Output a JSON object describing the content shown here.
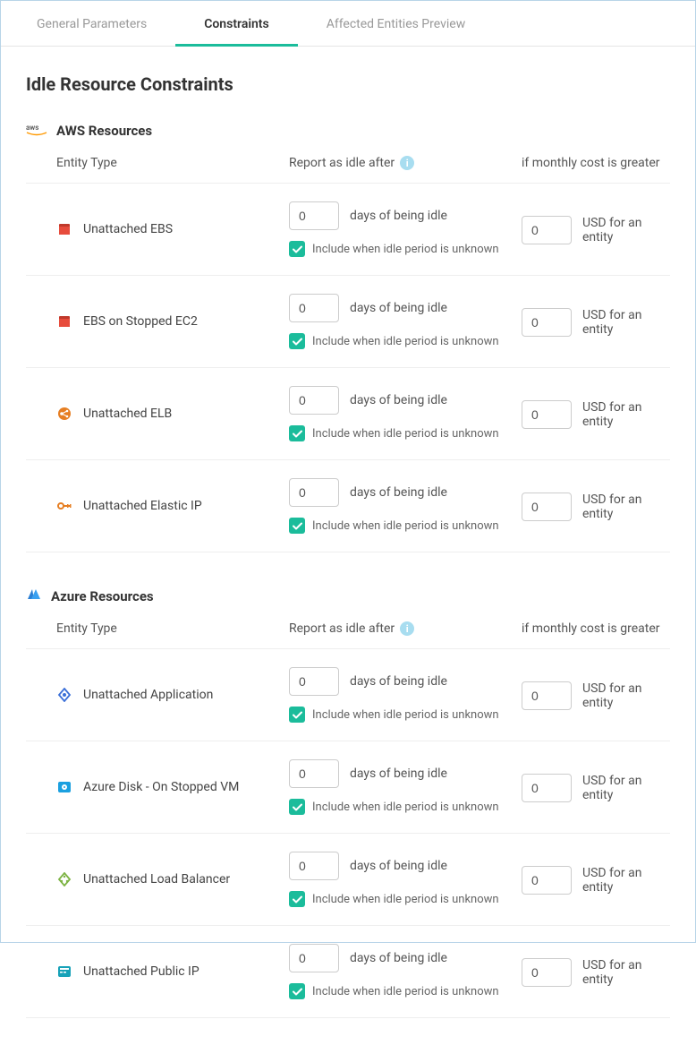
{
  "tabs": {
    "general": "General Parameters",
    "constraints": "Constraints",
    "affected": "Affected Entities Preview"
  },
  "page_title": "Idle Resource Constraints",
  "columns": {
    "entity": "Entity Type",
    "idle": "Report as idle after",
    "cost": "if monthly cost is greater"
  },
  "labels": {
    "days": "days of being idle",
    "include_unknown": "Include when idle period is unknown",
    "usd_entity": "USD for an entity"
  },
  "sections": [
    {
      "title": "AWS Resources",
      "rows": [
        {
          "name": "Unattached EBS",
          "days": "0",
          "cost": "0",
          "include": true,
          "iconKey": "ebs"
        },
        {
          "name": "EBS on Stopped EC2",
          "days": "0",
          "cost": "0",
          "include": true,
          "iconKey": "ebs"
        },
        {
          "name": "Unattached ELB",
          "days": "0",
          "cost": "0",
          "include": true,
          "iconKey": "elb"
        },
        {
          "name": "Unattached Elastic IP",
          "days": "0",
          "cost": "0",
          "include": true,
          "iconKey": "eip"
        }
      ]
    },
    {
      "title": "Azure Resources",
      "rows": [
        {
          "name": "Unattached Application",
          "days": "0",
          "cost": "0",
          "include": true,
          "iconKey": "azapp"
        },
        {
          "name": "Azure Disk - On Stopped VM",
          "days": "0",
          "cost": "0",
          "include": true,
          "iconKey": "azdisk"
        },
        {
          "name": "Unattached Load Balancer",
          "days": "0",
          "cost": "0",
          "include": true,
          "iconKey": "azlb"
        },
        {
          "name": "Unattached Public IP",
          "days": "0",
          "cost": "0",
          "include": true,
          "iconKey": "azip"
        }
      ]
    }
  ]
}
